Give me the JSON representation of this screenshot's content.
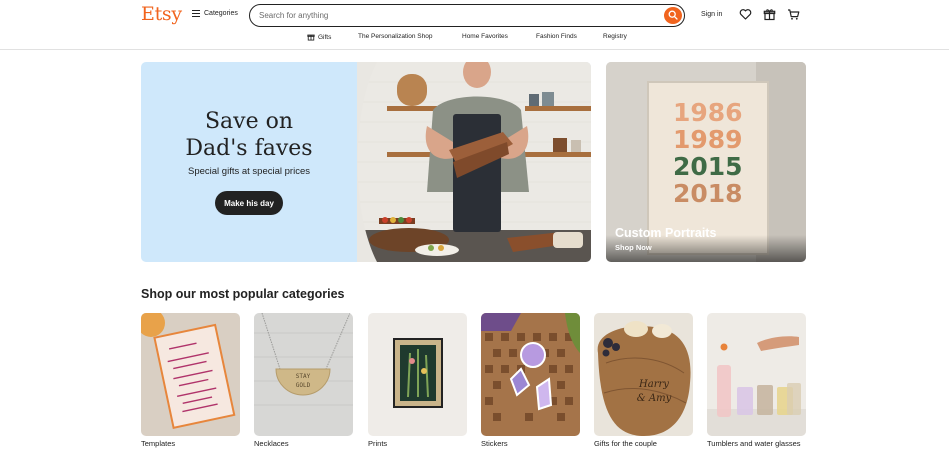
{
  "header": {
    "logo": "Etsy",
    "categories_label": "Categories",
    "search": {
      "placeholder": "Search for anything",
      "value": ""
    },
    "sign_in": "Sign in",
    "icons": [
      "menu-icon",
      "search-icon",
      "heart-icon",
      "gift-icon",
      "cart-icon"
    ]
  },
  "subnav": {
    "gifts": "Gifts",
    "personalization": "The Personalization Shop",
    "home_favorites": "Home Favorites",
    "fashion_finds": "Fashion Finds",
    "registry": "Registry"
  },
  "hero": {
    "title_line1": "Save on",
    "title_line2": "Dad's faves",
    "subtitle": "Special gifts at special prices",
    "button": "Make his day"
  },
  "side_promo": {
    "years": [
      "1986",
      "1989",
      "2015",
      "2018"
    ],
    "title": "Custom Portraits",
    "link": "Shop Now"
  },
  "popular": {
    "title": "Shop our most popular categories",
    "items": [
      {
        "label": "Templates"
      },
      {
        "label": "Necklaces",
        "image_text": "STAY GOLD"
      },
      {
        "label": "Prints"
      },
      {
        "label": "Stickers"
      },
      {
        "label": "Gifts for the couple",
        "image_text": "Harry & Amy"
      },
      {
        "label": "Tumblers and water glasses"
      }
    ]
  },
  "colors": {
    "brand": "#f1641e",
    "hero_bg": "#cfe8fb",
    "text": "#222222",
    "button_bg": "#222222"
  }
}
